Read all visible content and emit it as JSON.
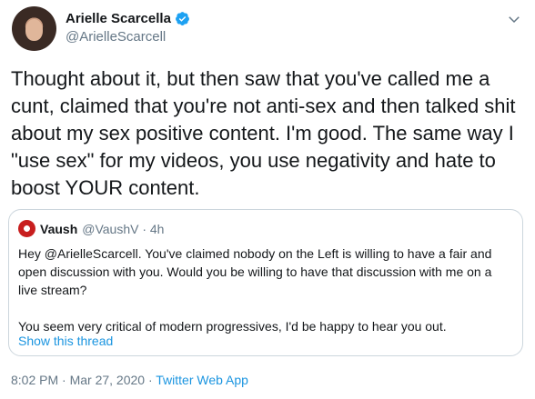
{
  "author": {
    "display_name": "Arielle Scarcella",
    "handle": "@ArielleScarcell"
  },
  "tweet": {
    "text": "Thought about it, but then saw that you've called me a cunt, claimed that you're not anti-sex and then talked shit about my sex positive content. I'm good. The same way I \"use sex\" for my videos, you use negativity and hate to boost YOUR content."
  },
  "quote": {
    "display_name": "Vaush",
    "handle_time": "@VaushV · 4h",
    "paragraph_1": "Hey @ArielleScarcell. You've claimed nobody on the Left is willing to have a fair and open discussion with you. Would you be willing to have that discussion with me on a live stream?",
    "paragraph_2": "You seem very critical of modern progressives, I'd be happy to hear you out.",
    "show_thread": "Show this thread"
  },
  "meta": {
    "timestamp": "8:02 PM · Mar 27, 2020 · ",
    "source": "Twitter Web App"
  },
  "colors": {
    "link": "#1b95e0",
    "secondary_text": "#657786",
    "border": "#ccd6dd"
  },
  "icons": [
    "verified-icon",
    "chevron-down-icon"
  ]
}
